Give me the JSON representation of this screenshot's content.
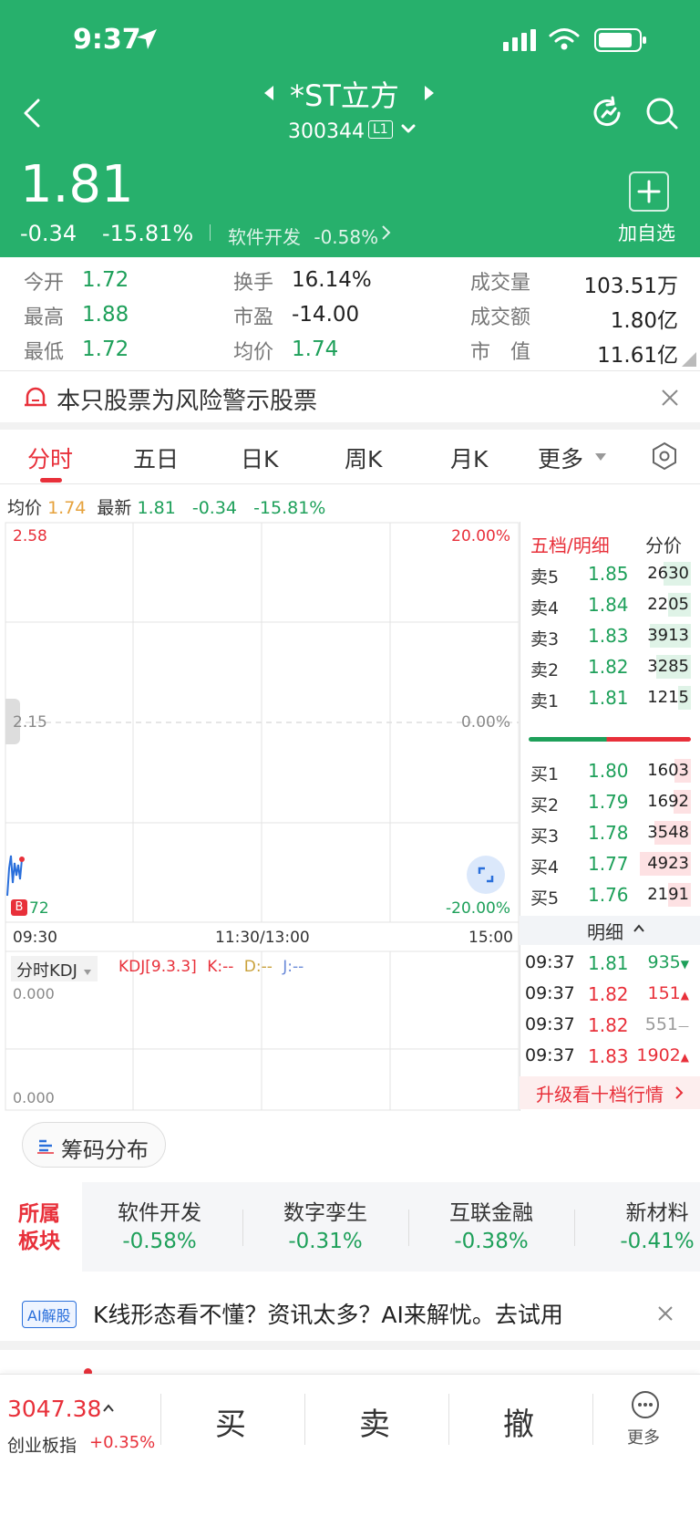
{
  "status_bar": {
    "time": "9:37"
  },
  "header": {
    "stock_name": "*ST立方",
    "code": "300344",
    "level": "L1",
    "price": "1.81",
    "change": "-0.34",
    "change_pct": "-15.81%",
    "sector": "软件开发",
    "sector_pct": "-0.58%",
    "add_watch_label": "加自选"
  },
  "quote": {
    "col1": [
      {
        "label": "今开",
        "value": "1.72"
      },
      {
        "label": "最高",
        "value": "1.88"
      },
      {
        "label": "最低",
        "value": "1.72"
      }
    ],
    "col2": [
      {
        "label": "换手",
        "value": "16.14%"
      },
      {
        "label": "市盈",
        "value": "-14.00"
      },
      {
        "label": "均价",
        "value": "1.74"
      }
    ],
    "col3": [
      {
        "label": "成交量",
        "value": "103.51万"
      },
      {
        "label": "成交额",
        "value": "1.80亿"
      },
      {
        "label": "市　值",
        "value": "11.61亿"
      }
    ]
  },
  "warning": {
    "text": "本只股票为风险警示股票"
  },
  "tabs": [
    "分时",
    "五日",
    "日K",
    "周K",
    "月K",
    "更多"
  ],
  "avg_line": {
    "avg_label": "均价",
    "avg_value": "1.74",
    "latest_label": "最新",
    "latest_value": "1.81",
    "change": "-0.34",
    "pct": "-15.81%"
  },
  "chart": {
    "top_price": "2.58",
    "top_pct": "20.00%",
    "mid_price": "2.15",
    "mid_pct": "0.00%",
    "bottom_price": "72",
    "bottom_pct": "-20.00%",
    "marker": "B",
    "times": [
      "09:30",
      "11:30/13:00",
      "15:00"
    ]
  },
  "kdj": {
    "selector": "分时KDJ",
    "params": "KDJ[9.3.3]",
    "k": "K:--",
    "d": "D:--",
    "j": "J:--",
    "v1": "0.000",
    "v2": "0.000"
  },
  "orderbook": {
    "title": "五档/明细",
    "tab2": "分价",
    "asks": [
      {
        "label": "卖5",
        "price": "1.85",
        "vol": "2630",
        "frac": 0.53
      },
      {
        "label": "卖4",
        "price": "1.84",
        "vol": "2205",
        "frac": 0.45
      },
      {
        "label": "卖3",
        "price": "1.83",
        "vol": "3913",
        "frac": 0.8
      },
      {
        "label": "卖2",
        "price": "1.82",
        "vol": "3285",
        "frac": 0.67
      },
      {
        "label": "卖1",
        "price": "1.81",
        "vol": "1215",
        "frac": 0.25
      }
    ],
    "bids": [
      {
        "label": "买1",
        "price": "1.80",
        "vol": "1603",
        "frac": 0.33
      },
      {
        "label": "买2",
        "price": "1.79",
        "vol": "1692",
        "frac": 0.34
      },
      {
        "label": "买3",
        "price": "1.78",
        "vol": "3548",
        "frac": 0.72
      },
      {
        "label": "买4",
        "price": "1.77",
        "vol": "4923",
        "frac": 1.0
      },
      {
        "label": "买5",
        "price": "1.76",
        "vol": "2191",
        "frac": 0.45
      }
    ],
    "detail_label": "明细",
    "ticks": [
      {
        "time": "09:37",
        "price": "1.81",
        "vol": "935",
        "dir": "down"
      },
      {
        "time": "09:37",
        "price": "1.82",
        "vol": "151",
        "dir": "up"
      },
      {
        "time": "09:37",
        "price": "1.82",
        "vol": "551",
        "dir": "flat"
      },
      {
        "time": "09:37",
        "price": "1.83",
        "vol": "1902",
        "dir": "up"
      }
    ],
    "upgrade": "升级看十档行情"
  },
  "chip_button": "筹码分布",
  "sectors": {
    "title1": "所属",
    "title2": "板块",
    "items": [
      {
        "name": "软件开发",
        "pct": "-0.58%"
      },
      {
        "name": "数字孪生",
        "pct": "-0.31%"
      },
      {
        "name": "互联金融",
        "pct": "-0.38%"
      },
      {
        "name": "新材料",
        "pct": "-0.41%"
      }
    ]
  },
  "ai_banner": {
    "badge": "AI解股",
    "text": "K线形态看不懂？资讯太多？AI来解忧。去试用"
  },
  "bottom": {
    "index_value": "3047.38",
    "index_name": "创业板指",
    "index_pct": "+0.35%",
    "buy": "买",
    "sell": "卖",
    "cancel": "撤",
    "more": "更多"
  }
}
